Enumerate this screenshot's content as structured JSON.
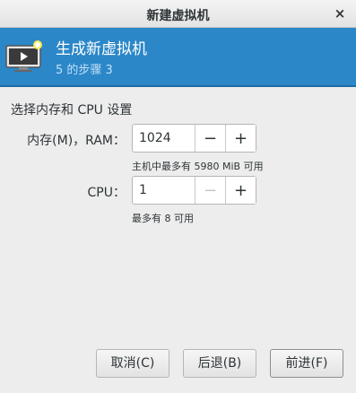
{
  "window": {
    "title": "新建虚拟机",
    "close_label": "×"
  },
  "banner": {
    "title": "生成新虚拟机",
    "subtitle": "5 的步骤 3",
    "icon": "vm-monitor-icon"
  },
  "form": {
    "section_label": "选择内存和 CPU 设置",
    "memory": {
      "label": "内存(M)，RAM：",
      "value": "1024",
      "decrement_label": "−",
      "increment_label": "+",
      "hint": "主机中最多有 5980 MiB 可用"
    },
    "cpu": {
      "label": "CPU：",
      "value": "1",
      "decrement_label": "−",
      "increment_label": "+",
      "hint": "最多有 8 可用"
    }
  },
  "buttons": {
    "cancel": "取消(C)",
    "back": "后退(B)",
    "forward": "前进(F)"
  },
  "colors": {
    "banner_bg": "#2c87c8",
    "banner_subtitle": "#bfe0f7"
  }
}
